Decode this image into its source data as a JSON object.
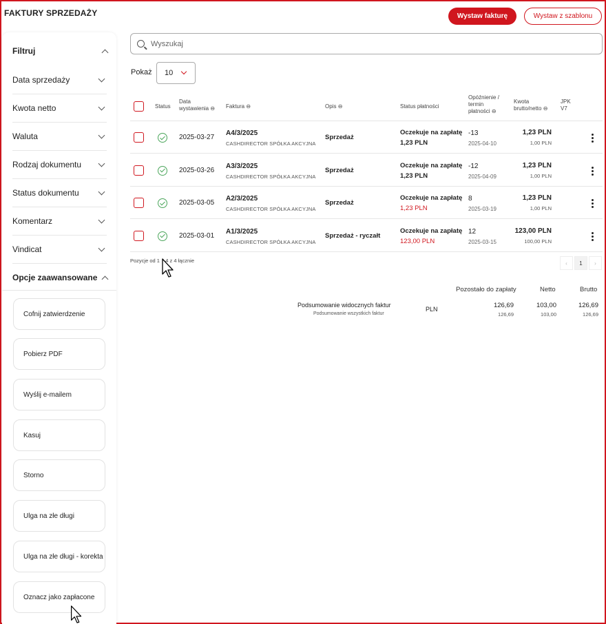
{
  "header": {
    "title": "FAKTURY SPRZEDAŻY",
    "primary_btn": "Wystaw fakturę",
    "secondary_btn": "Wystaw z szablonu"
  },
  "sidebar": {
    "filter_title": "Filtruj",
    "filters": [
      "Data sprzedaży",
      "Kwota netto",
      "Waluta",
      "Rodzaj dokumentu",
      "Status dokumentu",
      "Komentarz",
      "Vindicat"
    ],
    "advanced_title": "Opcje zaawansowane",
    "actions": [
      "Cofnij zatwierdzenie",
      "Pobierz PDF",
      "Wyślij e-mailem",
      "Kasuj",
      "Storno",
      "Ulga na złe długi",
      "Ulga na złe długi - korekta",
      "Oznacz jako zapłacone"
    ]
  },
  "search": {
    "placeholder": "Wyszukaj"
  },
  "page_size": {
    "label": "Pokaż",
    "value": "10"
  },
  "table": {
    "headers": {
      "status": "Status",
      "date_l1": "Data",
      "date_l2": "wystawienia",
      "invoice": "Faktura",
      "desc": "Opis",
      "pay_status": "Status płatności",
      "delay_l1": "Opóźnienie /",
      "delay_l2": "termin",
      "delay_l3": "płatności",
      "amount_l1": "Kwota",
      "amount_l2": "brutto/netto",
      "jpk_l1": "JPK",
      "jpk_l2": "V7"
    },
    "rows": [
      {
        "date": "2025-03-27",
        "number": "A4/3/2025",
        "client": "CASHDIRECTOR SPÓŁKA AKCYJNA",
        "desc": "Sprzedaż",
        "pay_status": "Oczekuje na zapłatę",
        "pay_amount": "1,23 PLN",
        "pay_red": false,
        "delay": "-13",
        "due": "2025-04-10",
        "gross": "1,23 PLN",
        "net": "1,00 PLN"
      },
      {
        "date": "2025-03-26",
        "number": "A3/3/2025",
        "client": "CASHDIRECTOR SPÓŁKA AKCYJNA",
        "desc": "Sprzedaż",
        "pay_status": "Oczekuje na zapłatę",
        "pay_amount": "1,23 PLN",
        "pay_red": false,
        "delay": "-12",
        "due": "2025-04-09",
        "gross": "1,23 PLN",
        "net": "1,00 PLN"
      },
      {
        "date": "2025-03-05",
        "number": "A2/3/2025",
        "client": "CASHDIRECTOR SPÓŁKA AKCYJNA",
        "desc": "Sprzedaż",
        "pay_status": "Oczekuje na zapłatę",
        "pay_amount": "1,23 PLN",
        "pay_red": true,
        "delay": "8",
        "due": "2025-03-19",
        "gross": "1,23 PLN",
        "net": "1,00 PLN"
      },
      {
        "date": "2025-03-01",
        "number": "A1/3/2025",
        "client": "CASHDIRECTOR SPÓŁKA AKCYJNA",
        "desc": "Sprzedaż - ryczałt",
        "pay_status": "Oczekuje na zapłatę",
        "pay_amount": "123,00 PLN",
        "pay_red": true,
        "delay": "12",
        "due": "2025-03-15",
        "gross": "123,00 PLN",
        "net": "100,00 PLN"
      }
    ],
    "positions_a": "Pozycje od 1",
    "positions_b": "4 z 4 łącznie",
    "current_page": "1",
    "page_prev": "‹",
    "page_next": "›"
  },
  "summary": {
    "col_remaining": "Pozostało do zapłaty",
    "col_net": "Netto",
    "col_gross": "Brutto",
    "visible_label": "Podsumowanie widocznych faktur",
    "all_label": "Podsumowanie wszystkich faktur",
    "currency": "PLN",
    "visible_remaining": "126,69",
    "visible_net": "103,00",
    "visible_gross": "126,69",
    "all_remaining": "126,69",
    "all_net": "103,00",
    "all_gross": "126,69"
  },
  "colors": {
    "accent": "#d0161e",
    "ok": "#4aa55a"
  }
}
